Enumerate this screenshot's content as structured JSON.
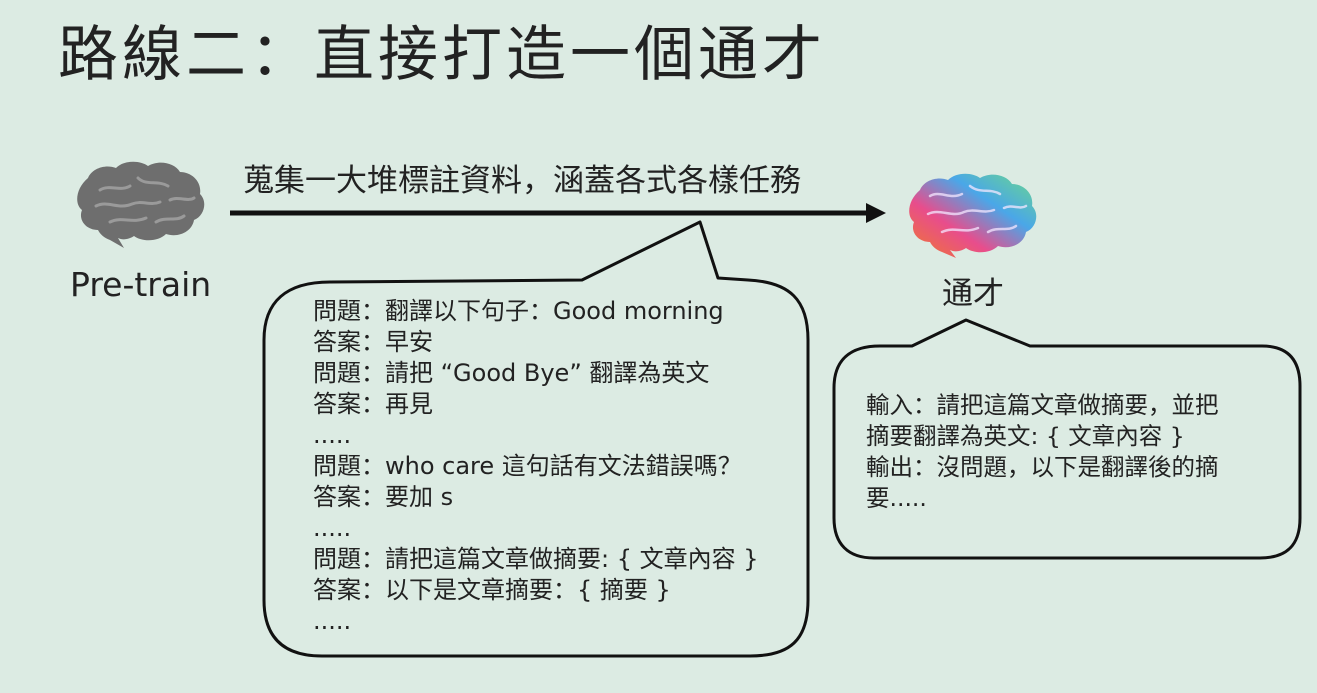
{
  "title": "路線二：直接打造一個通才",
  "arrow_label": "蒐集一大堆標註資料，涵蓋各式各樣任務",
  "pretrain_label": "Pre-train",
  "generalist_label": "通才",
  "icons": {
    "pretrain_brain": "brain-icon-gray",
    "generalist_brain": "brain-icon-rainbow"
  },
  "colors": {
    "background": "#dcebe3",
    "bubble_border": "#1a1a1a",
    "gray_brain": "#6e6e6e"
  },
  "training_bubble": {
    "lines": [
      "問題：翻譯以下句子：Good morning",
      "答案：早安",
      "問題：請把 “Good Bye” 翻譯為英文",
      "答案：再見",
      ".....",
      "問題：who care 這句話有文法錯誤嗎？",
      "答案：要加 s",
      ".....",
      "問題：請把這篇文章做摘要: { 文章內容 }",
      "答案：以下是文章摘要：{ 摘要 }",
      "....."
    ]
  },
  "generalist_bubble": {
    "lines": [
      "輸入：請把這篇文章做摘要，並把",
      "摘要翻譯為英文: { 文章內容 }",
      "輸出：沒問題，以下是翻譯後的摘",
      "要....."
    ]
  }
}
